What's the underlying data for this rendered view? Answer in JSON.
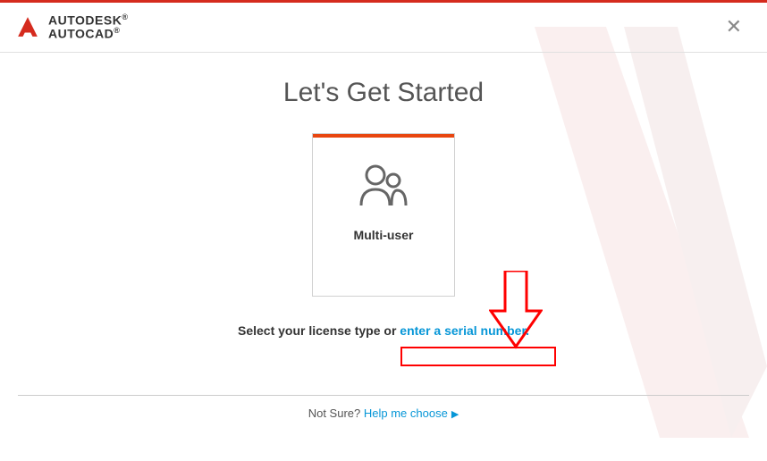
{
  "brand": {
    "line1": "AUTODESK",
    "line2": "AUTOCAD"
  },
  "title": "Let's Get Started",
  "card": {
    "label": "Multi-user"
  },
  "prompt": {
    "prefix": "Select your license type or ",
    "link": "enter a serial number."
  },
  "footer": {
    "prefix": "Not Sure? ",
    "link": "Help me choose"
  }
}
